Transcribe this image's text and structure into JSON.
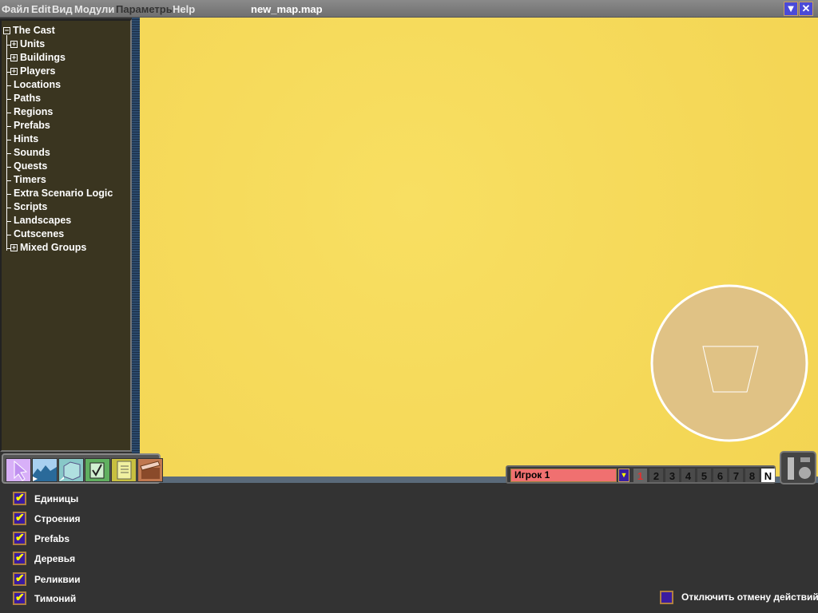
{
  "menubar": {
    "items": [
      "Файл",
      "Edit",
      "Вид",
      "Модули",
      "Параметры",
      "Help"
    ],
    "title": "new_map.map"
  },
  "tree": {
    "root": "The Cast",
    "items": [
      {
        "label": "Units",
        "expandable": true
      },
      {
        "label": "Buildings",
        "expandable": true
      },
      {
        "label": "Players",
        "expandable": true
      },
      {
        "label": "Locations"
      },
      {
        "label": "Paths"
      },
      {
        "label": "Regions"
      },
      {
        "label": "Prefabs"
      },
      {
        "label": "Hints"
      },
      {
        "label": "Sounds"
      },
      {
        "label": "Quests"
      },
      {
        "label": "Timers"
      },
      {
        "label": "Extra Scenario Logic"
      },
      {
        "label": "Scripts"
      },
      {
        "label": "Landscapes"
      },
      {
        "label": "Cutscenes"
      },
      {
        "label": "Mixed Groups",
        "expandable": true
      }
    ]
  },
  "tools": [
    "select-tool",
    "terrain-tool",
    "object-tool",
    "triggers-tool",
    "notes-tool",
    "cutscene-tool"
  ],
  "player": {
    "selected": "Игрок 1",
    "numbers": [
      "1",
      "2",
      "3",
      "4",
      "5",
      "6",
      "7",
      "8",
      "N"
    ],
    "active": "1"
  },
  "filters": [
    {
      "label": "Единицы",
      "checked": true
    },
    {
      "label": "Строения",
      "checked": true
    },
    {
      "label": "Prefabs",
      "checked": true
    },
    {
      "label": "Деревья",
      "checked": true
    },
    {
      "label": "Реликвии",
      "checked": true
    },
    {
      "label": "Тимоний",
      "checked": true
    }
  ],
  "undo_option": {
    "label": "Отключить отмену действий",
    "checked": false
  },
  "colors": {
    "map": "#f5d95a",
    "panel": "#3a3520",
    "accent": "#3a1ca0"
  }
}
